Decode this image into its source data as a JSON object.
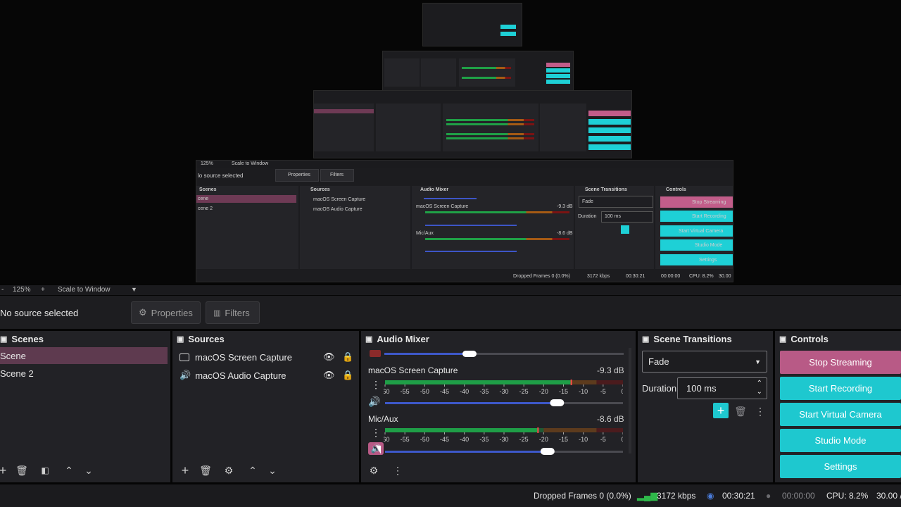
{
  "zoombar": {
    "zoom": "125%",
    "scale_mode": "Scale to Window"
  },
  "source_bar": {
    "status": "No source selected",
    "properties": "Properties",
    "filters": "Filters"
  },
  "scenes": {
    "title": "Scenes",
    "items": [
      "Scene",
      "Scene 2"
    ]
  },
  "sources": {
    "title": "Sources",
    "items": [
      "macOS Screen Capture",
      "macOS Audio Capture"
    ]
  },
  "audio_mixer": {
    "title": "Audio Mixer",
    "channels": [
      {
        "name": "macOS Screen Capture",
        "db": "-9.3 dB",
        "level": 0.78,
        "volume": 0.72
      },
      {
        "name": "Mic/Aux",
        "db": "-8.6 dB",
        "level": 0.64,
        "volume": 0.68
      }
    ],
    "scale": [
      "-60",
      "-55",
      "-50",
      "-45",
      "-40",
      "-35",
      "-30",
      "-25",
      "-20",
      "-15",
      "-10",
      "-5",
      "0"
    ]
  },
  "scene_transitions": {
    "title": "Scene Transitions",
    "transition": "Fade",
    "duration_label": "Duration",
    "duration": "100 ms"
  },
  "controls": {
    "title": "Controls",
    "buttons": [
      "Stop Streaming",
      "Start Recording",
      "Start Virtual Camera",
      "Studio Mode",
      "Settings"
    ]
  },
  "status": {
    "dropped": "Dropped Frames 0 (0.0%)",
    "bitrate": "3172 kbps",
    "stream_time": "00:30:21",
    "rec_time": "00:00:00",
    "cpu": "CPU: 8.2%",
    "fps": "30.00 /"
  },
  "colors": {
    "accent": "#1ec8cf",
    "stop_streaming": "#b85a86",
    "scene_selected": "#5e3a4f",
    "meter_green": "#1f9e47",
    "meter_orange": "#a65a14",
    "meter_red": "#7e1414",
    "slider": "#3d58c9"
  }
}
